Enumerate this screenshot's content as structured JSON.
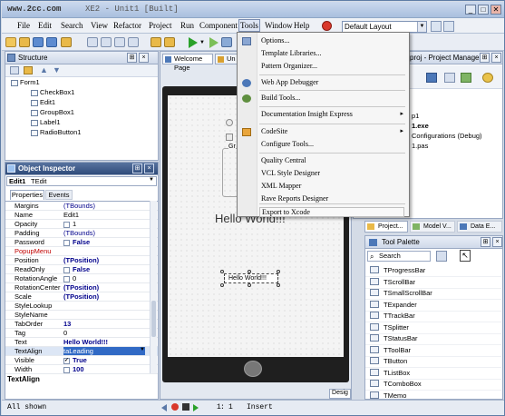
{
  "window": {
    "watermark": "www.2cc.com",
    "title_fragment": "XE2 - Unit1 [Built]",
    "ctrl_min": "_",
    "ctrl_max": "□",
    "ctrl_close": "✕"
  },
  "menubar": {
    "items": [
      "File",
      "Edit",
      "Search",
      "View",
      "Refactor",
      "Project",
      "Run",
      "Component",
      "Tools",
      "Window",
      "Help"
    ],
    "layout_combo": "Default Layout",
    "active": "Tools"
  },
  "tools_menu": {
    "items": [
      {
        "label": "Options..."
      },
      {
        "label": "Template Libraries..."
      },
      {
        "label": "Pattern Organizer..."
      },
      {
        "label": "Web App Debugger"
      },
      {
        "label": "Build Tools..."
      },
      {
        "label": "Documentation Insight Express",
        "submenu": true
      },
      {
        "label": "CodeSite",
        "submenu": true
      },
      {
        "label": "Configure Tools..."
      },
      {
        "label": "Quality Central"
      },
      {
        "label": "VCL Style Designer"
      },
      {
        "label": "XML Mapper"
      },
      {
        "label": "Rave Reports Designer"
      },
      {
        "label": "Export to Xcode"
      }
    ]
  },
  "structure": {
    "title": "Structure",
    "root": "Form1",
    "children": [
      "CheckBox1",
      "Edit1",
      "GroupBox1",
      "Label1",
      "RadioButton1"
    ]
  },
  "inspector": {
    "title": "Object Inspector",
    "selected": "Edit1",
    "selected_type": "TEdit",
    "tabs": [
      "Properties",
      "Events"
    ],
    "rows": [
      {
        "name": "Margins",
        "value": "(TBounds)",
        "style": "link"
      },
      {
        "name": "Name",
        "value": "Edit1",
        "style": ""
      },
      {
        "name": "Opacity",
        "value": "1",
        "style": "",
        "check": true
      },
      {
        "name": "Padding",
        "value": "(TBounds)",
        "style": "link"
      },
      {
        "name": "Password",
        "value": "False",
        "style": "bold",
        "check": true
      },
      {
        "name": "PopupMenu",
        "value": "",
        "style": "",
        "red": true
      },
      {
        "name": "Position",
        "value": "(TPosition)",
        "style": "bold"
      },
      {
        "name": "ReadOnly",
        "value": "False",
        "style": "bold",
        "check": true
      },
      {
        "name": "RotationAngle",
        "value": "0",
        "style": "",
        "check": true
      },
      {
        "name": "RotationCenter",
        "value": "(TPosition)",
        "style": "bold"
      },
      {
        "name": "Scale",
        "value": "(TPosition)",
        "style": "bold"
      },
      {
        "name": "StyleLookup",
        "value": "",
        "style": ""
      },
      {
        "name": "StyleName",
        "value": "",
        "style": ""
      },
      {
        "name": "TabOrder",
        "value": "13",
        "style": "bold"
      },
      {
        "name": "Tag",
        "value": "0",
        "style": ""
      },
      {
        "name": "Text",
        "value": "Hello World!!!",
        "style": "bold"
      },
      {
        "name": "TextAlign",
        "value": "taLeading",
        "style": "selected"
      },
      {
        "name": "Visible",
        "value": "True",
        "style": "bold",
        "check": true,
        "checked": true
      },
      {
        "name": "Width",
        "value": "100",
        "style": "bold",
        "check": true
      }
    ],
    "footer": "TextAlign",
    "footer_status": "All shown"
  },
  "designer": {
    "tabs": [
      "Welcome Page",
      "Un"
    ],
    "big_label": "Hello World!!!",
    "edit_text": "Hello World!!!",
    "groupbox_fragment": "Gr"
  },
  "project_manager": {
    "title": "proj - Project Manager",
    "items": [
      "p1",
      "1.exe",
      "Configurations (Debug)",
      "1.pas"
    ]
  },
  "palette": {
    "tabs": [
      "Project...",
      "Model V...",
      "Data E..."
    ],
    "title": "Tool Palette",
    "search_label": "Search",
    "items": [
      "TProgressBar",
      "TScrollBar",
      "TSmallScrollBar",
      "TExpander",
      "TTrackBar",
      "TSplitter",
      "TStatusBar",
      "TToolBar",
      "TButton",
      "TListBox",
      "TComboBox",
      "TMemo"
    ]
  },
  "statusbar": {
    "line": "1",
    "col": "1",
    "mode": "Insert",
    "design_tab": "Desig"
  },
  "colors": {
    "accent": "#2f4b7a",
    "panel_border": "#9aa9c3",
    "form_dark": "#2a2a2a"
  }
}
